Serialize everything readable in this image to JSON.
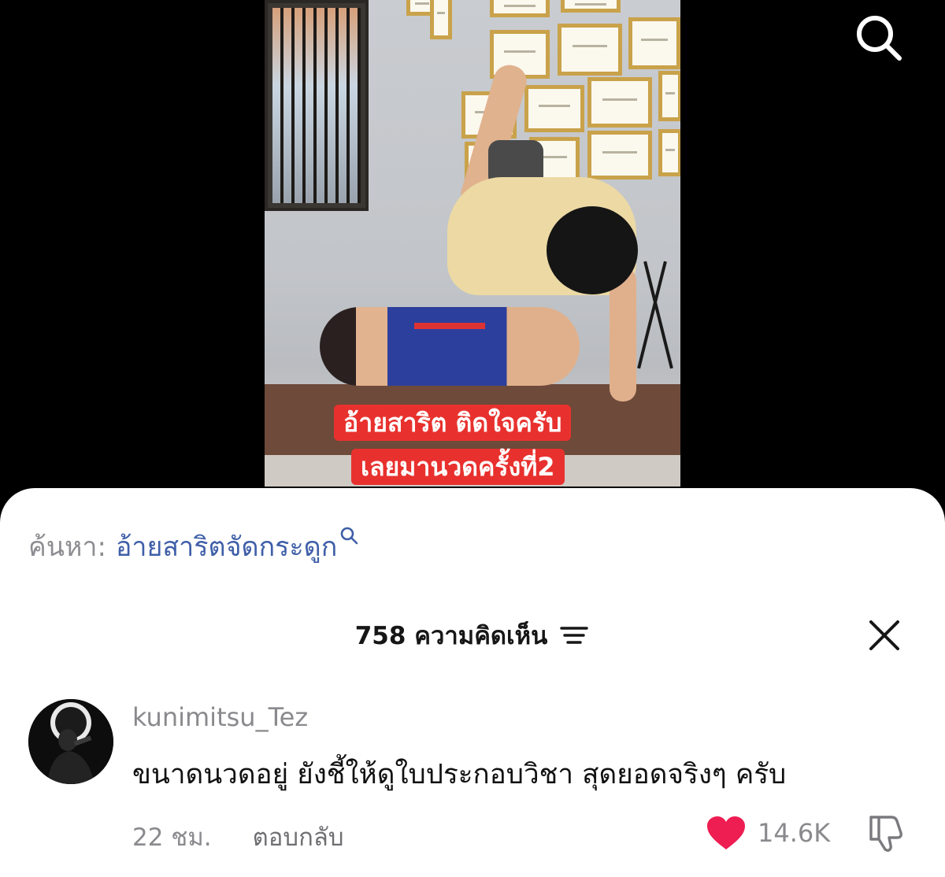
{
  "video": {
    "caption_line1": "อ้ายสาริต ติดใจครับ",
    "caption_line2": "เลยมานวดครั้งที่2",
    "search_icon": "search-icon"
  },
  "sheet": {
    "search_prefix": "ค้นหา:",
    "search_query": "อ้ายสาริตจัดกระดูก",
    "comments_title": "758 ความคิดเห็น",
    "sort_icon": "sort-icon",
    "close_icon": "close-icon"
  },
  "comment": {
    "username": "kunimitsu_Tez",
    "text": "ขนาดนวดอยู่ ยังชี้ให้ดูใบประกอบวิชา สุดยอดจริงๆ ครับ",
    "time": "22 ชม.",
    "reply_label": "ตอบกลับ",
    "like_count": "14.6K",
    "liked": true,
    "heart_color": "#ee1d52",
    "query_color": "#3f5fa8"
  }
}
